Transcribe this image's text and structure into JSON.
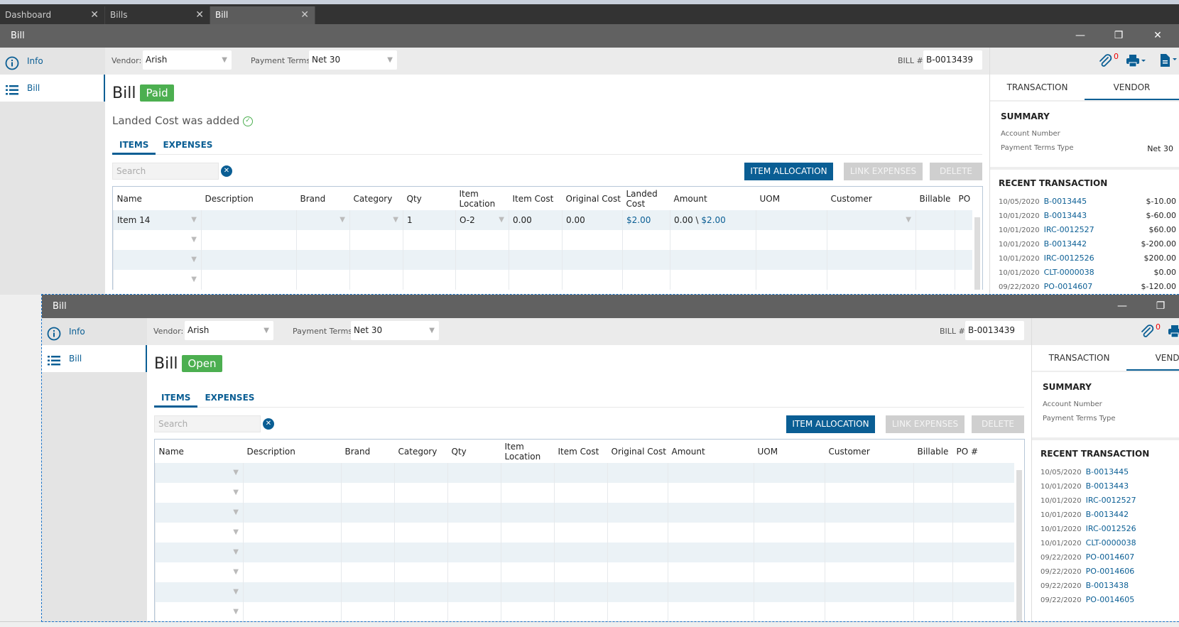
{
  "app_tabs": [
    {
      "label": "Dashboard"
    },
    {
      "label": "Bills"
    },
    {
      "label": "Bill",
      "active": true
    }
  ],
  "colors": {
    "accent": "#0a5e94",
    "paid": "#4caf50",
    "open": "#4caf50",
    "titlebar": "#616161"
  },
  "windows": [
    {
      "title": "Bill",
      "controls": {
        "minimize": "—",
        "restore": "❐",
        "close": "✕"
      },
      "vendor_label": "Vendor:",
      "vendor": "Arish",
      "terms_label": "Payment Terms:",
      "terms": "Net 30",
      "bill_label": "BILL #",
      "bill_no": "B-0013439",
      "sidebar": [
        {
          "label": "Info",
          "icon": "info-icon"
        },
        {
          "label": "Bill",
          "icon": "list-icon",
          "active": true
        }
      ],
      "heading": "Bill",
      "status": "Paid",
      "notice": "Landed Cost was added",
      "subtabs": [
        {
          "label": "ITEMS",
          "active": true
        },
        {
          "label": "EXPENSES"
        }
      ],
      "search_placeholder": "Search",
      "buttons": {
        "item_allocation": "ITEM ALLOCATION",
        "link_expenses": "LINK EXPENSES",
        "delete": "DELETE"
      },
      "columns": [
        {
          "key": "name",
          "label": "Name",
          "dropdown": true
        },
        {
          "key": "description",
          "label": "Description"
        },
        {
          "key": "brand",
          "label": "Brand",
          "dropdown": true
        },
        {
          "key": "category",
          "label": "Category",
          "dropdown": true
        },
        {
          "key": "qty",
          "label": "Qty"
        },
        {
          "key": "location",
          "label": "Item Location",
          "dropdown": true
        },
        {
          "key": "item_cost",
          "label": "Item Cost"
        },
        {
          "key": "original_cost",
          "label": "Original Cost"
        },
        {
          "key": "landed_cost",
          "label": "Landed Cost"
        },
        {
          "key": "amount",
          "label": "Amount"
        },
        {
          "key": "uom",
          "label": "UOM"
        },
        {
          "key": "customer",
          "label": "Customer",
          "dropdown": true
        },
        {
          "key": "billable",
          "label": "Billable"
        },
        {
          "key": "po",
          "label": "PO"
        }
      ],
      "rows": [
        {
          "name": "Item 14",
          "qty": "1",
          "location": "O-2",
          "item_cost": "0.00",
          "original_cost": "0.00",
          "landed_cost": "$2.00",
          "amount": "0.00",
          "amount_separator": "\\",
          "amount_landed": "$2.00"
        },
        {},
        {},
        {}
      ],
      "attachments_count": "0",
      "panel_tabs": [
        {
          "label": "TRANSACTION"
        },
        {
          "label": "VENDOR",
          "active": true
        }
      ],
      "summary": {
        "title": "SUMMARY",
        "fields": [
          {
            "label": "Account Number",
            "value": ""
          },
          {
            "label": "Payment Terms Type",
            "value": "Net 30"
          }
        ]
      },
      "recent": {
        "title": "RECENT TRANSACTION",
        "items": [
          {
            "date": "10/05/2020",
            "id": "B-0013445",
            "amount": "$-10.00"
          },
          {
            "date": "10/01/2020",
            "id": "B-0013443",
            "amount": "$-60.00"
          },
          {
            "date": "10/01/2020",
            "id": "IRC-0012527",
            "amount": "$60.00"
          },
          {
            "date": "10/01/2020",
            "id": "B-0013442",
            "amount": "$-200.00"
          },
          {
            "date": "10/01/2020",
            "id": "IRC-0012526",
            "amount": "$200.00"
          },
          {
            "date": "10/01/2020",
            "id": "CLT-0000038",
            "amount": "$0.00"
          },
          {
            "date": "09/22/2020",
            "id": "PO-0014607",
            "amount": "$-120.00"
          }
        ]
      }
    },
    {
      "title": "Bill",
      "controls": {
        "minimize": "—",
        "restore": "❐",
        "close": "✕"
      },
      "vendor_label": "Vendor:",
      "vendor": "Arish",
      "terms_label": "Payment Terms:",
      "terms": "Net 30",
      "bill_label": "BILL #",
      "bill_no": "B-0013439",
      "sidebar": [
        {
          "label": "Info",
          "icon": "info-icon"
        },
        {
          "label": "Bill",
          "icon": "list-icon",
          "active": true
        }
      ],
      "heading": "Bill",
      "status": "Open",
      "subtabs": [
        {
          "label": "ITEMS",
          "active": true
        },
        {
          "label": "EXPENSES"
        }
      ],
      "search_placeholder": "Search",
      "buttons": {
        "item_allocation": "ITEM ALLOCATION",
        "link_expenses": "LINK EXPENSES",
        "delete": "DELETE"
      },
      "columns": [
        {
          "key": "name",
          "label": "Name",
          "dropdown": true
        },
        {
          "key": "description",
          "label": "Description"
        },
        {
          "key": "brand",
          "label": "Brand",
          "dropdown": true
        },
        {
          "key": "category",
          "label": "Category",
          "dropdown": true
        },
        {
          "key": "qty",
          "label": "Qty"
        },
        {
          "key": "location",
          "label": "Item Location",
          "dropdown": true
        },
        {
          "key": "item_cost",
          "label": "Item Cost"
        },
        {
          "key": "original_cost",
          "label": "Original Cost"
        },
        {
          "key": "amount",
          "label": "Amount"
        },
        {
          "key": "uom",
          "label": "UOM"
        },
        {
          "key": "customer",
          "label": "Customer",
          "dropdown": true
        },
        {
          "key": "billable",
          "label": "Billable"
        },
        {
          "key": "po",
          "label": "PO #"
        }
      ],
      "rows": [
        {},
        {},
        {},
        {},
        {},
        {},
        {},
        {}
      ],
      "attachments_count": "0",
      "panel_tabs": [
        {
          "label": "TRANSACTION"
        },
        {
          "label": "VENDOR",
          "active": true
        }
      ],
      "summary": {
        "title": "SUMMARY",
        "fields": [
          {
            "label": "Account Number",
            "value": ""
          },
          {
            "label": "Payment Terms Type",
            "value": ""
          }
        ]
      },
      "recent": {
        "title": "RECENT TRANSACTION",
        "items": [
          {
            "date": "10/05/2020",
            "id": "B-0013445"
          },
          {
            "date": "10/01/2020",
            "id": "B-0013443"
          },
          {
            "date": "10/01/2020",
            "id": "IRC-0012527"
          },
          {
            "date": "10/01/2020",
            "id": "B-0013442"
          },
          {
            "date": "10/01/2020",
            "id": "IRC-0012526"
          },
          {
            "date": "10/01/2020",
            "id": "CLT-0000038"
          },
          {
            "date": "09/22/2020",
            "id": "PO-0014607"
          },
          {
            "date": "09/22/2020",
            "id": "PO-0014606"
          },
          {
            "date": "09/22/2020",
            "id": "B-0013438"
          },
          {
            "date": "09/22/2020",
            "id": "PO-0014605"
          }
        ]
      }
    }
  ]
}
